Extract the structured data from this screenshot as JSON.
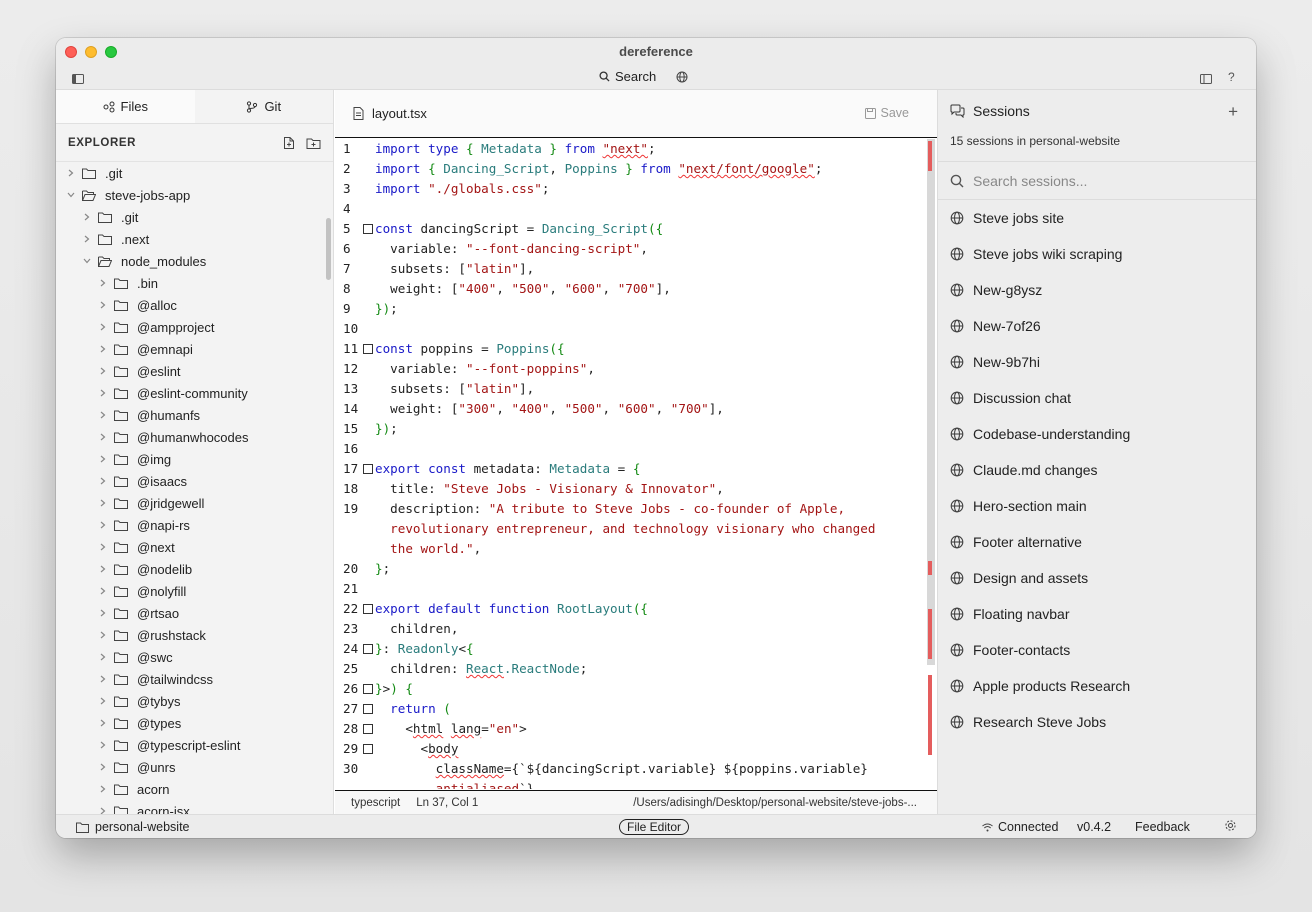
{
  "window": {
    "title": "dereference"
  },
  "toolbar": {
    "search_label": "Search"
  },
  "sidebar": {
    "tabs": [
      {
        "label": "Files"
      },
      {
        "label": "Git"
      }
    ],
    "explorer_title": "EXPLORER",
    "tree": [
      {
        "label": ".git",
        "depth": 0,
        "open": false
      },
      {
        "label": "steve-jobs-app",
        "depth": 0,
        "open": true
      },
      {
        "label": ".git",
        "depth": 1,
        "open": false
      },
      {
        "label": ".next",
        "depth": 1,
        "open": false
      },
      {
        "label": "node_modules",
        "depth": 1,
        "open": true
      },
      {
        "label": ".bin",
        "depth": 2,
        "open": false
      },
      {
        "label": "@alloc",
        "depth": 2,
        "open": false
      },
      {
        "label": "@ampproject",
        "depth": 2,
        "open": false
      },
      {
        "label": "@emnapi",
        "depth": 2,
        "open": false
      },
      {
        "label": "@eslint",
        "depth": 2,
        "open": false
      },
      {
        "label": "@eslint-community",
        "depth": 2,
        "open": false
      },
      {
        "label": "@humanfs",
        "depth": 2,
        "open": false
      },
      {
        "label": "@humanwhocodes",
        "depth": 2,
        "open": false
      },
      {
        "label": "@img",
        "depth": 2,
        "open": false
      },
      {
        "label": "@isaacs",
        "depth": 2,
        "open": false
      },
      {
        "label": "@jridgewell",
        "depth": 2,
        "open": false
      },
      {
        "label": "@napi-rs",
        "depth": 2,
        "open": false
      },
      {
        "label": "@next",
        "depth": 2,
        "open": false
      },
      {
        "label": "@nodelib",
        "depth": 2,
        "open": false
      },
      {
        "label": "@nolyfill",
        "depth": 2,
        "open": false
      },
      {
        "label": "@rtsao",
        "depth": 2,
        "open": false
      },
      {
        "label": "@rushstack",
        "depth": 2,
        "open": false
      },
      {
        "label": "@swc",
        "depth": 2,
        "open": false
      },
      {
        "label": "@tailwindcss",
        "depth": 2,
        "open": false
      },
      {
        "label": "@tybys",
        "depth": 2,
        "open": false
      },
      {
        "label": "@types",
        "depth": 2,
        "open": false
      },
      {
        "label": "@typescript-eslint",
        "depth": 2,
        "open": false
      },
      {
        "label": "@unrs",
        "depth": 2,
        "open": false
      },
      {
        "label": "acorn",
        "depth": 2,
        "open": false
      },
      {
        "label": "acorn-jsx",
        "depth": 2,
        "open": false
      }
    ]
  },
  "editor": {
    "filename": "layout.tsx",
    "save_label": "Save",
    "lines": [
      {
        "n": "1",
        "fold": false,
        "parts": [
          [
            "kw",
            "import type "
          ],
          [
            "br",
            "{ "
          ],
          [
            "ty",
            "Metadata"
          ],
          [
            "br",
            " }"
          ],
          [
            "kw",
            " from "
          ],
          [
            "stsq",
            "\"next\""
          ],
          [
            "",
            "; "
          ]
        ]
      },
      {
        "n": "2",
        "fold": false,
        "parts": [
          [
            "kw",
            "import "
          ],
          [
            "br",
            "{ "
          ],
          [
            "ty",
            "Dancing_Script"
          ],
          [
            "",
            ", "
          ],
          [
            "ty",
            "Poppins"
          ],
          [
            "br",
            " }"
          ],
          [
            "kw",
            " from "
          ],
          [
            "stsq",
            "\"next/font/google\""
          ],
          [
            "",
            ";"
          ]
        ]
      },
      {
        "n": "3",
        "fold": false,
        "parts": [
          [
            "kw",
            "import "
          ],
          [
            "st",
            "\"./globals.css\""
          ],
          [
            "",
            ";"
          ]
        ]
      },
      {
        "n": "4",
        "fold": false,
        "parts": []
      },
      {
        "n": "5",
        "fold": true,
        "parts": [
          [
            "kw",
            "const "
          ],
          [
            "",
            "dancingScript = "
          ],
          [
            "ty",
            "Dancing_Script"
          ],
          [
            "br",
            "({"
          ]
        ]
      },
      {
        "n": "6",
        "fold": false,
        "parts": [
          [
            "",
            "  variable: "
          ],
          [
            "st",
            "\"--font-dancing-script\""
          ],
          [
            "",
            ","
          ]
        ]
      },
      {
        "n": "7",
        "fold": false,
        "parts": [
          [
            "",
            "  subsets: ["
          ],
          [
            "st",
            "\"latin\""
          ],
          [
            "",
            "],"
          ]
        ]
      },
      {
        "n": "8",
        "fold": false,
        "parts": [
          [
            "",
            "  weight: ["
          ],
          [
            "st",
            "\"400\""
          ],
          [
            "",
            ", "
          ],
          [
            "st",
            "\"500\""
          ],
          [
            "",
            ", "
          ],
          [
            "st",
            "\"600\""
          ],
          [
            "",
            ", "
          ],
          [
            "st",
            "\"700\""
          ],
          [
            "",
            "],"
          ]
        ]
      },
      {
        "n": "9",
        "fold": false,
        "parts": [
          [
            "br",
            "})"
          ],
          [
            "",
            ";"
          ]
        ]
      },
      {
        "n": "10",
        "fold": false,
        "parts": []
      },
      {
        "n": "11",
        "fold": true,
        "parts": [
          [
            "kw",
            "const "
          ],
          [
            "",
            "poppins = "
          ],
          [
            "ty",
            "Poppins"
          ],
          [
            "br",
            "({"
          ]
        ]
      },
      {
        "n": "12",
        "fold": false,
        "parts": [
          [
            "",
            "  variable: "
          ],
          [
            "st",
            "\"--font-poppins\""
          ],
          [
            "",
            ","
          ]
        ]
      },
      {
        "n": "13",
        "fold": false,
        "parts": [
          [
            "",
            "  subsets: ["
          ],
          [
            "st",
            "\"latin\""
          ],
          [
            "",
            "],"
          ]
        ]
      },
      {
        "n": "14",
        "fold": false,
        "parts": [
          [
            "",
            "  weight: ["
          ],
          [
            "st",
            "\"300\""
          ],
          [
            "",
            ", "
          ],
          [
            "st",
            "\"400\""
          ],
          [
            "",
            ", "
          ],
          [
            "st",
            "\"500\""
          ],
          [
            "",
            ", "
          ],
          [
            "st",
            "\"600\""
          ],
          [
            "",
            ", "
          ],
          [
            "st",
            "\"700\""
          ],
          [
            "",
            "],"
          ]
        ]
      },
      {
        "n": "15",
        "fold": false,
        "parts": [
          [
            "br",
            "})"
          ],
          [
            "",
            ";"
          ]
        ]
      },
      {
        "n": "16",
        "fold": false,
        "parts": []
      },
      {
        "n": "17",
        "fold": true,
        "parts": [
          [
            "kw",
            "export const "
          ],
          [
            "",
            "metadata: "
          ],
          [
            "ty",
            "Metadata"
          ],
          [
            "",
            " = "
          ],
          [
            "br",
            "{"
          ]
        ]
      },
      {
        "n": "18",
        "fold": false,
        "parts": [
          [
            "",
            "  title: "
          ],
          [
            "st",
            "\"Steve Jobs - Visionary & Innovator\""
          ],
          [
            "",
            ","
          ]
        ]
      },
      {
        "n": "19",
        "fold": false,
        "parts": [
          [
            "",
            "  description: "
          ],
          [
            "st",
            "\"A tribute to Steve Jobs - co-founder of Apple,"
          ]
        ]
      },
      {
        "n": "",
        "fold": false,
        "parts": [
          [
            "st",
            "  revolutionary entrepreneur, and technology visionary who changed"
          ]
        ]
      },
      {
        "n": "",
        "fold": false,
        "parts": [
          [
            "st",
            "  the world.\""
          ],
          [
            "",
            ","
          ]
        ]
      },
      {
        "n": "20",
        "fold": false,
        "parts": [
          [
            "br",
            "}"
          ],
          [
            "",
            ";"
          ]
        ]
      },
      {
        "n": "21",
        "fold": false,
        "parts": []
      },
      {
        "n": "22",
        "fold": true,
        "parts": [
          [
            "kw",
            "export default function "
          ],
          [
            "ty",
            "RootLayout"
          ],
          [
            "br",
            "({"
          ]
        ]
      },
      {
        "n": "23",
        "fold": false,
        "parts": [
          [
            "",
            "  children,"
          ]
        ]
      },
      {
        "n": "24",
        "fold": true,
        "parts": [
          [
            "br",
            "}"
          ],
          [
            ": "
          ],
          [
            "ty",
            "Readonly"
          ],
          [
            "",
            "<"
          ],
          [
            "br",
            "{"
          ]
        ]
      },
      {
        "n": "25",
        "fold": false,
        "parts": [
          [
            "",
            "  children: "
          ],
          [
            "tysq",
            "React"
          ],
          [
            "ty",
            ".ReactNode"
          ],
          [
            "",
            ";"
          ]
        ]
      },
      {
        "n": "26",
        "fold": true,
        "parts": [
          [
            "br",
            "}"
          ],
          [
            ">"
          ],
          [
            "br",
            ") {"
          ]
        ]
      },
      {
        "n": "27",
        "fold": true,
        "parts": [
          [
            "kw",
            "  return "
          ],
          [
            "br",
            "("
          ]
        ]
      },
      {
        "n": "28",
        "fold": true,
        "parts": [
          [
            "",
            "    <"
          ],
          [
            "sq",
            "html"
          ],
          [
            " "
          ],
          [
            "sq",
            "lang"
          ],
          [
            "",
            "="
          ],
          [
            "st",
            "\"en\""
          ],
          [
            "",
            ">"
          ]
        ]
      },
      {
        "n": "29",
        "fold": true,
        "parts": [
          [
            "",
            "      <"
          ],
          [
            "sq",
            "body"
          ]
        ]
      },
      {
        "n": "30",
        "fold": false,
        "parts": [
          [
            "",
            "        "
          ],
          [
            "sq",
            "className"
          ],
          [
            "",
            "={`${dancingScript.variable} ${poppins.variable}"
          ]
        ]
      },
      {
        "n": "",
        "fold": false,
        "parts": [
          [
            "stsq",
            "        antialiased"
          ],
          [
            "",
            "`}"
          ]
        ]
      }
    ]
  },
  "statusbar": {
    "language": "typescript",
    "position": "Ln 37, Col 1",
    "path": "/Users/adisingh/Desktop/personal-website/steve-jobs-..."
  },
  "sessions": {
    "title": "Sessions",
    "subtitle": "15 sessions in personal-website",
    "search_placeholder": "Search sessions...",
    "items": [
      {
        "label": "Steve jobs site"
      },
      {
        "label": "Steve jobs wiki scraping"
      },
      {
        "label": "New-g8ysz"
      },
      {
        "label": "New-7of26"
      },
      {
        "label": "New-9b7hi"
      },
      {
        "label": "Discussion chat"
      },
      {
        "label": "Codebase-understanding"
      },
      {
        "label": "Claude.md changes"
      },
      {
        "label": "Hero-section main"
      },
      {
        "label": "Footer alternative"
      },
      {
        "label": "Design and assets"
      },
      {
        "label": "Floating navbar"
      },
      {
        "label": "Footer-contacts"
      },
      {
        "label": "Apple products Research"
      },
      {
        "label": "Research Steve Jobs"
      }
    ]
  },
  "bottombar": {
    "project": "personal-website",
    "mode": "File Editor",
    "connection": "Connected",
    "version": "v0.4.2",
    "feedback": "Feedback"
  }
}
